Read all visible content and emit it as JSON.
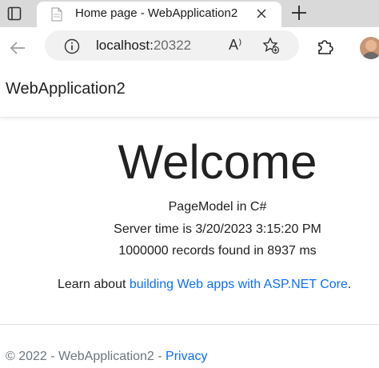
{
  "browser": {
    "tab": {
      "title": "Home page - WebApplication2",
      "close": "✕"
    },
    "new_tab": "+",
    "url": {
      "host": "localhost:",
      "port": "20322"
    },
    "read_aloud": "A⁾"
  },
  "page": {
    "brand": "WebApplication2",
    "welcome": "Welcome",
    "lines": [
      "PageModel in C#",
      "Server time is 3/20/2023 3:15:20 PM",
      "1000000 records found in 8937 ms"
    ],
    "learn_prefix": "Learn about ",
    "learn_link": "building Web apps with ASP.NET Core",
    "learn_suffix": ".",
    "footer_prefix": "© 2022 - WebApplication2 - ",
    "footer_link": "Privacy"
  },
  "colors": {
    "link": "#0d6efd",
    "tabstrip": "#d9d9d9",
    "omnibox": "#f1f1f1"
  }
}
